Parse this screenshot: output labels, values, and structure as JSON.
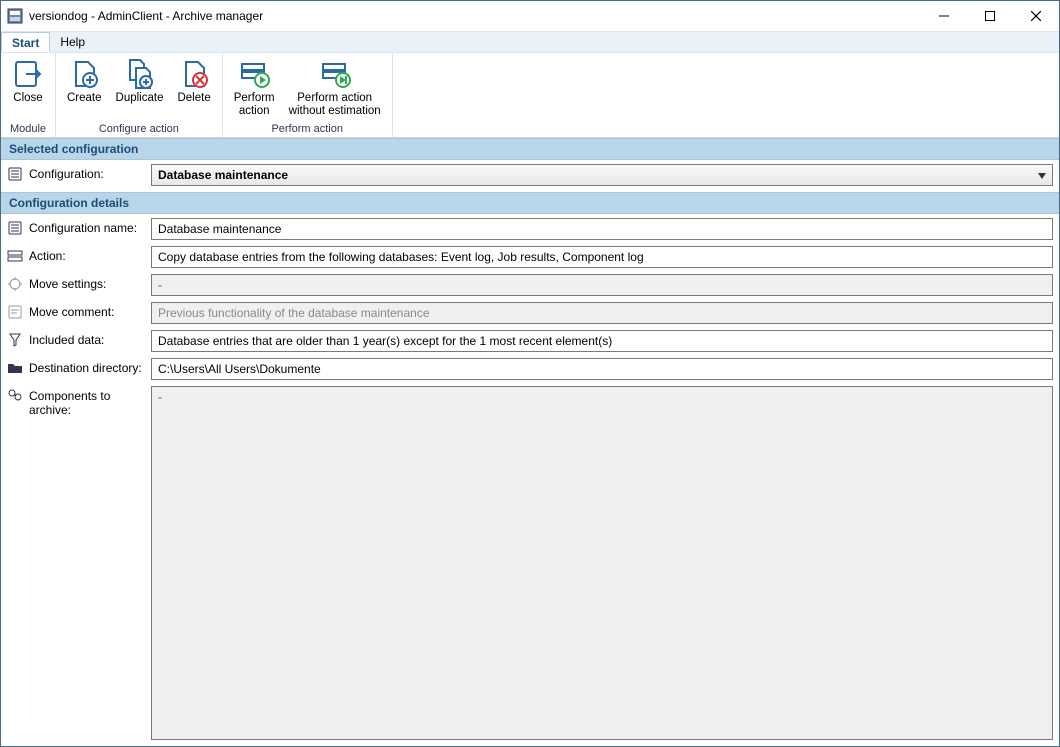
{
  "window": {
    "title": "versiondog - AdminClient - Archive manager"
  },
  "menu": {
    "start": "Start",
    "help": "Help"
  },
  "ribbon": {
    "close": "Close",
    "create": "Create",
    "duplicate": "Duplicate",
    "delete": "Delete",
    "perform_action": "Perform\naction",
    "perform_no_estimation": "Perform action\nwithout estimation",
    "group_module": "Module",
    "group_configure": "Configure action",
    "group_perform": "Perform action"
  },
  "sections": {
    "selected_configuration": "Selected configuration",
    "configuration_details": "Configuration details"
  },
  "selected": {
    "label": "Configuration:",
    "value": "Database maintenance"
  },
  "details": {
    "configuration_name": {
      "label": "Configuration name:",
      "value": "Database maintenance"
    },
    "action": {
      "label": "Action:",
      "value": "Copy database entries from the following databases: Event log, Job results, Component log"
    },
    "move_settings": {
      "label": "Move settings:",
      "value": "-"
    },
    "move_comment": {
      "label": "Move comment:",
      "value": "Previous functionality of the database maintenance"
    },
    "included_data": {
      "label": "Included data:",
      "value": "Database entries that are older than 1 year(s) except for the 1 most recent element(s)"
    },
    "destination_directory": {
      "label": "Destination directory:",
      "value": "C:\\Users\\All Users\\Dokumente"
    },
    "components_to_archive": {
      "label": "Components to archive:",
      "value": "-"
    }
  }
}
